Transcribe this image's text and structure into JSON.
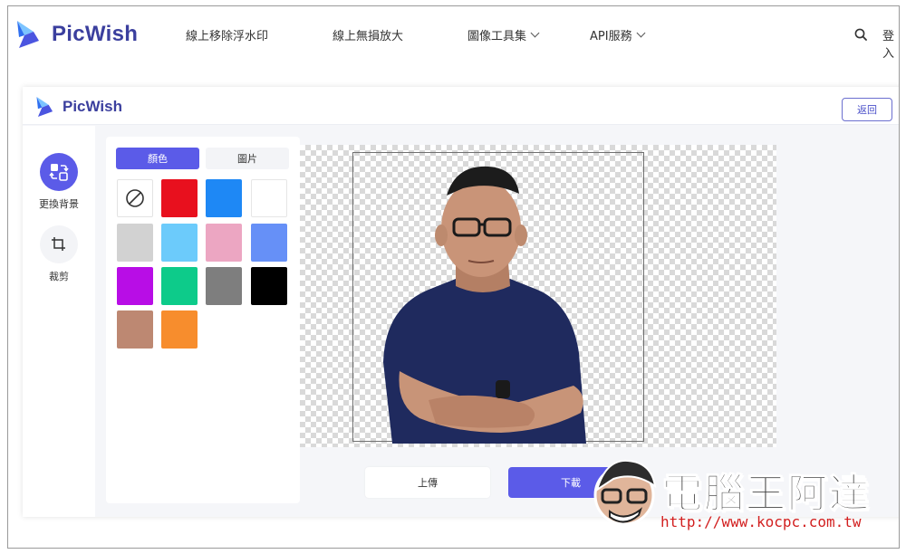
{
  "topnav": {
    "brand": "PicWish",
    "items": [
      {
        "label": "線上移除浮水印",
        "has_dropdown": false
      },
      {
        "label": "線上無損放大",
        "has_dropdown": false
      },
      {
        "label": "圖像工具集",
        "has_dropdown": true
      },
      {
        "label": "API服務",
        "has_dropdown": true
      }
    ],
    "login_label": "登入"
  },
  "editor": {
    "brand": "PicWish",
    "back_label": "返回",
    "tools": [
      {
        "label": "更換背景",
        "icon": "swap-background-icon",
        "active": true
      },
      {
        "label": "裁剪",
        "icon": "crop-icon",
        "active": false
      }
    ],
    "panel": {
      "tabs": [
        "顏色",
        "圖片"
      ],
      "active_tab": "顏色",
      "swatches": [
        {
          "name": "none",
          "color": "none"
        },
        {
          "name": "red",
          "color": "#e8101e"
        },
        {
          "name": "blue",
          "color": "#1e88f5"
        },
        {
          "name": "white",
          "color": "#ffffff"
        },
        {
          "name": "light-gray",
          "color": "#d2d2d2"
        },
        {
          "name": "sky-blue",
          "color": "#6ccbfb"
        },
        {
          "name": "pink",
          "color": "#eca6c2"
        },
        {
          "name": "periwinkle",
          "color": "#6690f7"
        },
        {
          "name": "purple",
          "color": "#b80de6"
        },
        {
          "name": "green",
          "color": "#0dcb8a"
        },
        {
          "name": "gray",
          "color": "#7e7e7e"
        },
        {
          "name": "black",
          "color": "#000000"
        },
        {
          "name": "brown",
          "color": "#bd8872"
        },
        {
          "name": "orange",
          "color": "#f78d2d"
        }
      ]
    },
    "upload_label": "上傳",
    "download_label": "下載"
  },
  "watermark": {
    "title": "電腦王阿達",
    "url": "http://www.kocpc.com.tw"
  },
  "colors": {
    "accent": "#5b5be8",
    "brand_text": "#3b3f9e"
  }
}
